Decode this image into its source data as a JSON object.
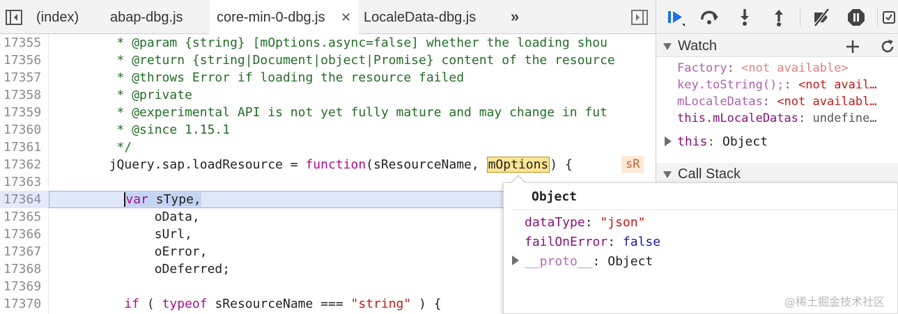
{
  "tabs": [
    {
      "label": "(index)",
      "active": false
    },
    {
      "label": "abap-dbg.js",
      "active": false
    },
    {
      "label": "core-min-0-dbg.js",
      "active": true
    },
    {
      "label": "LocaleData-dbg.js",
      "active": false
    }
  ],
  "tab_close_glyph": "✕",
  "tab_more_glyph": "»",
  "code_lines": [
    {
      "num": "17355",
      "text": "         * @param {string} [mOptions.async=false] whether the loading shou"
    },
    {
      "num": "17356",
      "text": "         * @return {string|Document|object|Promise} content of the resource"
    },
    {
      "num": "17357",
      "text": "         * @throws Error if loading the resource failed"
    },
    {
      "num": "17358",
      "text": "         * @private"
    },
    {
      "num": "17359",
      "text": "         * @experimental API is not yet fully mature and may change in fut"
    },
    {
      "num": "17360",
      "text": "         * @since 1.15.1"
    },
    {
      "num": "17361",
      "text": "         */"
    },
    {
      "num": "17362",
      "pre": "        jQuery.sap.loadResource = ",
      "kw": "function",
      "mid": "(sResourceName, ",
      "word": "mOptions",
      "post": ") {"
    },
    {
      "num": "17363",
      "text": ""
    },
    {
      "num": "17364",
      "indent": "          ",
      "kw": "var",
      "rest": " sType,"
    },
    {
      "num": "17365",
      "text": "              oData,"
    },
    {
      "num": "17366",
      "text": "              sUrl,"
    },
    {
      "num": "17367",
      "text": "              oError,"
    },
    {
      "num": "17368",
      "text": "              oDeferred;"
    },
    {
      "num": "17369",
      "text": ""
    },
    {
      "num": "17370",
      "indent": "          ",
      "kw1": "if",
      "a": " ( ",
      "kw2": "typeof",
      "b": " sResourceName === ",
      "str": "\"string\"",
      "c": " ) {"
    }
  ],
  "inline_value": "sR",
  "watch": {
    "title": "Watch",
    "items": [
      {
        "name": "Factory",
        "sep": ": ",
        "value": "<not available>",
        "na": true
      },
      {
        "name": "key.toString();",
        "sep": ": ",
        "value": "<not avail…",
        "na": true
      },
      {
        "name": "mLocaleDatas",
        "sep": ": ",
        "value": "<not availabl…",
        "na": true
      },
      {
        "name": "this.mLocaleDatas",
        "sep": ": ",
        "value": "undefine…",
        "na": false
      }
    ],
    "this_name": "this",
    "this_value": "Object"
  },
  "call_stack": {
    "title": "Call Stack"
  },
  "popover": {
    "title": "Object",
    "props": [
      {
        "key": "dataType",
        "value": "\"json\"",
        "kind": "string"
      },
      {
        "key": "failOnError",
        "value": "false",
        "kind": "bool"
      }
    ],
    "proto_key": "__proto__",
    "proto_value": "Object"
  },
  "watermark": "@稀土掘金技术社区",
  "colors": {
    "keyword": "#aa0d91",
    "comment": "#236e25",
    "string": "#c41a16",
    "accent": "#1a73e8",
    "exec_line": "#e2eafc"
  },
  "icons": [
    "panel-toggle-icon",
    "resume-icon",
    "step-over-icon",
    "step-into-icon",
    "step-out-icon",
    "deactivate-breakpoints-icon",
    "pause-on-exceptions-icon",
    "add-watch-icon",
    "refresh-watch-icon"
  ]
}
